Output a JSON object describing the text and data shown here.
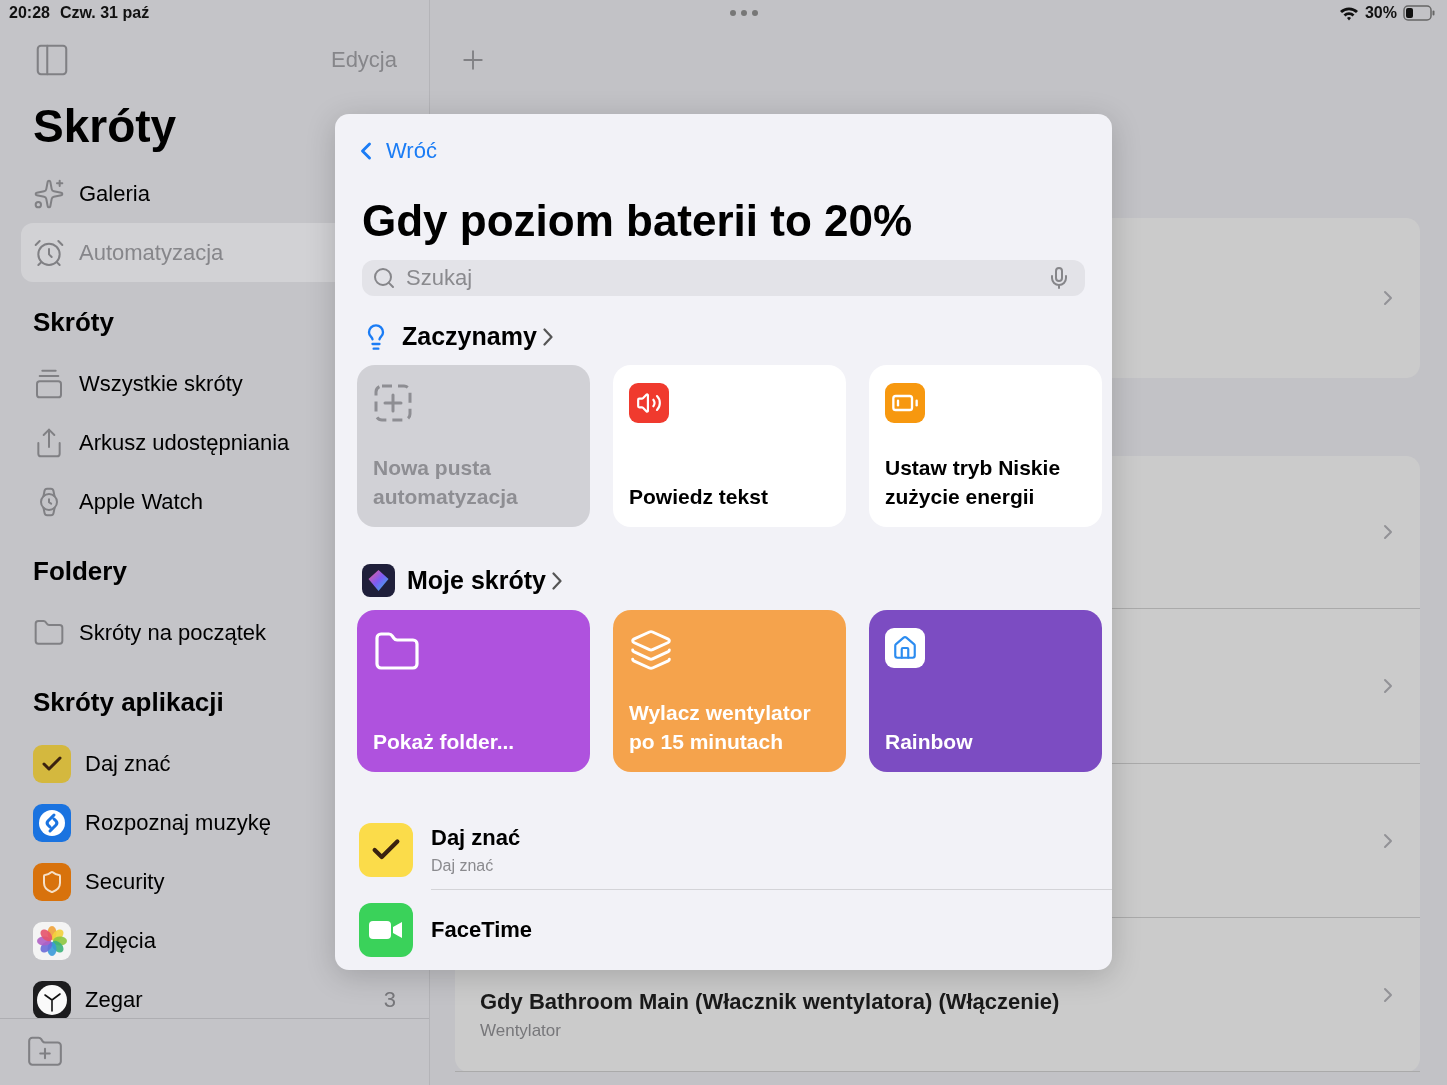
{
  "status_bar": {
    "time": "20:28",
    "date": "Czw. 31 paź",
    "battery": "30%"
  },
  "sidebar": {
    "edit_button": "Edycja",
    "title": "Skróty",
    "items": [
      {
        "label": "Galeria",
        "selected": false
      },
      {
        "label": "Automatyzacja",
        "selected": true
      }
    ],
    "sections": [
      {
        "title": "Skróty",
        "kind": "links",
        "items": [
          {
            "label": "Wszystkie skróty"
          },
          {
            "label": "Arkusz udostępniania"
          },
          {
            "label": "Apple Watch"
          }
        ]
      },
      {
        "title": "Foldery",
        "kind": "folders",
        "items": [
          {
            "label": "Skróty na początek"
          }
        ]
      },
      {
        "title": "Skróty aplikacji",
        "kind": "apps",
        "items": [
          {
            "label": "Daj znać"
          },
          {
            "label": "Rozpoznaj muzykę"
          },
          {
            "label": "Security"
          },
          {
            "label": "Zdjęcia"
          },
          {
            "label": "Zegar",
            "count": "3"
          }
        ]
      }
    ]
  },
  "automations": [
    {
      "title": "Gdy Bathroom Main (Włacznik wentylatora) (Włączenie)",
      "subtitle": "Wentylator"
    }
  ],
  "modal": {
    "back": "Wróć",
    "title": "Gdy poziom baterii to 20%",
    "search": {
      "placeholder": "Szukaj"
    },
    "sections": [
      {
        "title": "Zaczynamy",
        "kind": "actions",
        "tiles": [
          {
            "label": "Nowa pusta automatyzacja",
            "disabled": true
          },
          {
            "label": "Powiedz tekst",
            "disabled": false
          },
          {
            "label": "Ustaw tryb Niskie zużycie energii",
            "disabled": false
          }
        ]
      },
      {
        "title": "Moje skróty",
        "kind": "shortcuts",
        "tiles": [
          {
            "label": "Pokaż folder...",
            "color": "#af52de"
          },
          {
            "label": "Wylacz wentylator po 15 minutach",
            "color": "#f5a34c"
          },
          {
            "label": "Rainbow",
            "color": "#7c4cc2"
          }
        ]
      }
    ],
    "apps": [
      {
        "title": "Daj znać",
        "subtitle": "Daj znać"
      },
      {
        "title": "FaceTime"
      }
    ]
  }
}
